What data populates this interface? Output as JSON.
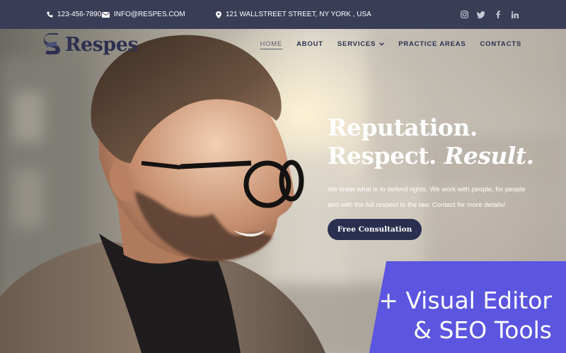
{
  "topbar": {
    "phone": "123-456-7890",
    "email": "INFO@RESPES.COM",
    "address": "121 WALLSTREET STREET, NY YORK , USA",
    "social": [
      "instagram-icon",
      "twitter-icon",
      "facebook-icon",
      "linkedin-icon"
    ]
  },
  "brand": {
    "name": "Respes"
  },
  "nav": {
    "home": "HOME",
    "about": "ABOUT",
    "services": "SERVICES",
    "practice": "PRACTICE AREAS",
    "contacts": "CONTACTS"
  },
  "hero": {
    "line1": "Reputation.",
    "line2a": "Respect.",
    "line2b": "Result.",
    "subtext": "We know what is to defend rights. We work with people, for people and with the full respect to the law. Contact for more details!",
    "cta": "Free Consultation"
  },
  "promo": {
    "line1": "+ Visual Editor",
    "line2": "& SEO Tools"
  },
  "colors": {
    "topbar": "#3a3d56",
    "brand": "#2d3050",
    "cta": "#2b2f4f",
    "promo": "#5b55e0"
  }
}
